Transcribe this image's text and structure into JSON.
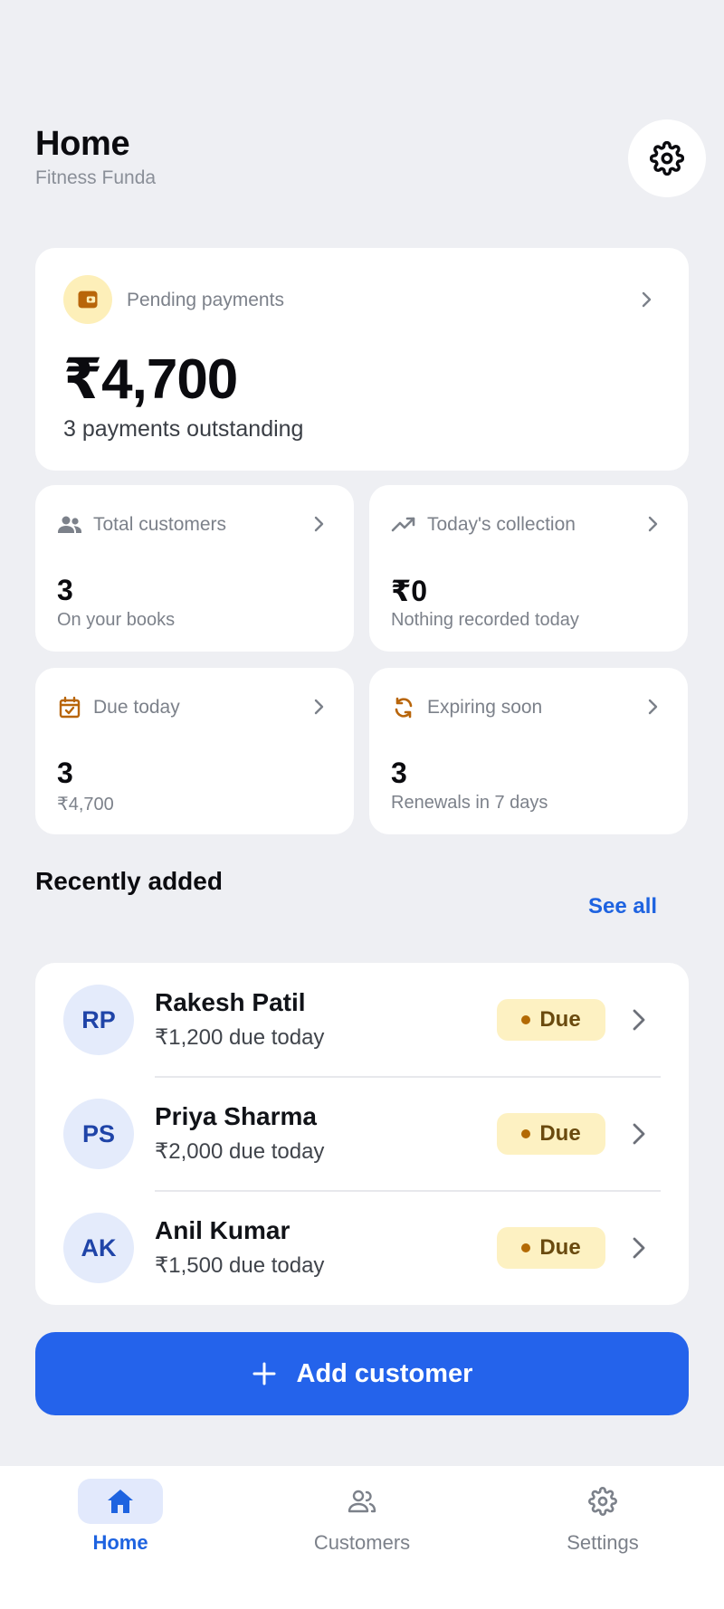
{
  "header": {
    "title": "Home",
    "subtitle": "Fitness Funda"
  },
  "pending": {
    "label": "Pending payments",
    "amount": "₹4,700",
    "sub": "3 payments outstanding"
  },
  "stats": [
    {
      "label": "Total customers",
      "value": "3",
      "caption": "On your books",
      "icon": "people-icon"
    },
    {
      "label": "Today's collection",
      "value": "₹0",
      "caption": "Nothing recorded today",
      "icon": "trending-up-icon"
    },
    {
      "label": "Due today",
      "value": "3",
      "caption": "₹4,700",
      "icon": "calendar-check-icon"
    },
    {
      "label": "Expiring soon",
      "value": "3",
      "caption": "Renewals in 7 days",
      "icon": "refresh-icon"
    }
  ],
  "recent": {
    "title": "Recently added",
    "see_all": "See all",
    "customers": [
      {
        "initials": "RP",
        "name": "Rakesh Patil",
        "due": "₹1,200 due today",
        "status": "Due"
      },
      {
        "initials": "PS",
        "name": "Priya Sharma",
        "due": "₹2,000 due today",
        "status": "Due"
      },
      {
        "initials": "AK",
        "name": "Anil Kumar",
        "due": "₹1,500 due today",
        "status": "Due"
      }
    ]
  },
  "add_button": {
    "label": "Add customer"
  },
  "nav": [
    {
      "label": "Home",
      "active": true
    },
    {
      "label": "Customers",
      "active": false
    },
    {
      "label": "Settings",
      "active": false
    }
  ],
  "colors": {
    "accent": "#2463EB",
    "background": "#EEEFF3",
    "due_badge": "#FDF1C2",
    "due_dot": "#B36A05"
  }
}
